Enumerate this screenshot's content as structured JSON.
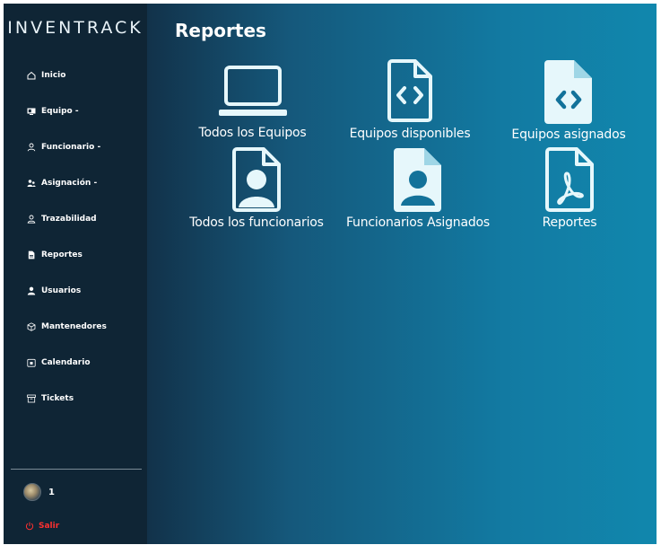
{
  "brand": {
    "name": "INVENTRACK"
  },
  "sidebar": {
    "items": [
      {
        "label": "Inicio",
        "icon": "home-icon"
      },
      {
        "label": "Equipo -",
        "icon": "monitor-icon"
      },
      {
        "label": "Funcionario -",
        "icon": "user-icon"
      },
      {
        "label": "Asignación -",
        "icon": "users-icon"
      },
      {
        "label": "Trazabilidad",
        "icon": "user-outline-icon"
      },
      {
        "label": "Reportes",
        "icon": "file-icon"
      },
      {
        "label": "Usuarios",
        "icon": "person-icon"
      },
      {
        "label": "Mantenedores",
        "icon": "cube-icon"
      },
      {
        "label": "Calendario",
        "icon": "calendar-icon"
      },
      {
        "label": "Tickets",
        "icon": "archive-icon"
      }
    ],
    "user_label": "1",
    "logout_label": "Salir"
  },
  "main": {
    "title": "Reportes",
    "cards": [
      {
        "label": "Todos los Equipos",
        "icon": "laptop-icon"
      },
      {
        "label": "Equipos disponibles",
        "icon": "file-code-outline-icon"
      },
      {
        "label": "Equipos asignados",
        "icon": "file-code-filled-icon"
      },
      {
        "label": "Todos los funcionarios",
        "icon": "file-person-outline-icon"
      },
      {
        "label": "Funcionarios Asignados",
        "icon": "file-person-filled-icon"
      },
      {
        "label": "Reportes",
        "icon": "file-pdf-icon"
      }
    ]
  },
  "colors": {
    "sidebar_bg": "#0f2535",
    "main_gradient_start": "#12324a",
    "main_gradient_end": "#1187ad",
    "logout": "#ff3030",
    "icon_fill": "#e6f7fb"
  }
}
